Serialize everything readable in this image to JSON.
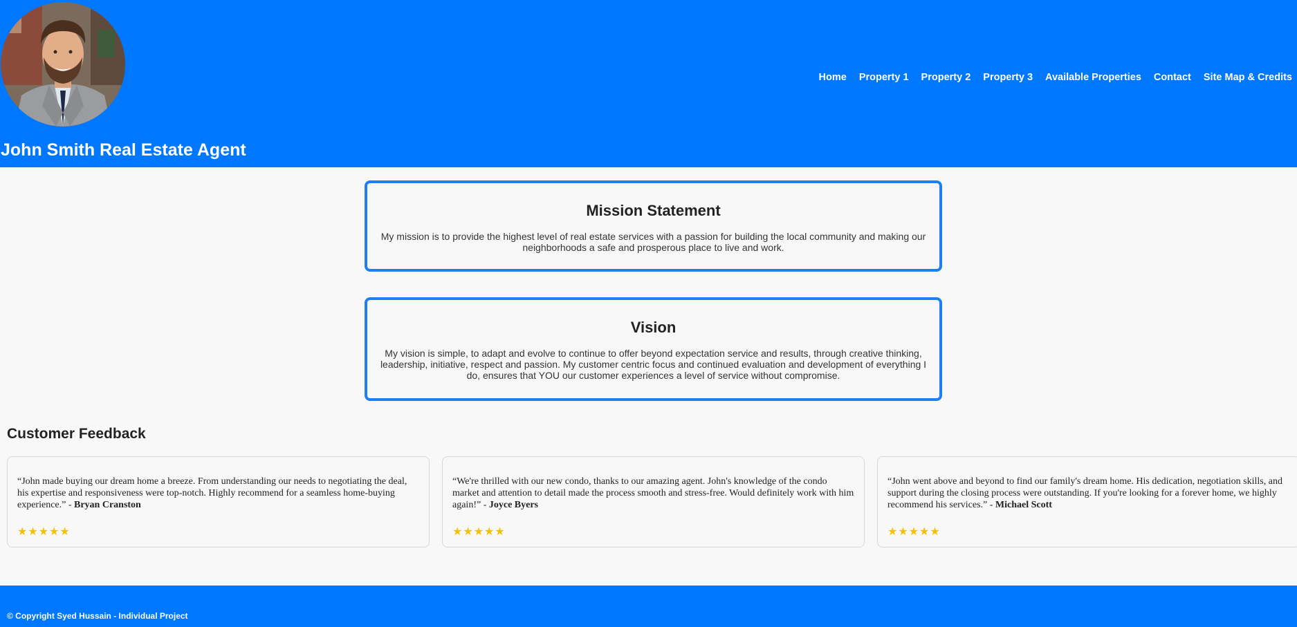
{
  "header": {
    "title": "John Smith Real Estate Agent",
    "nav": [
      "Home",
      "Property 1",
      "Property 2",
      "Property 3",
      "Available Properties",
      "Contact",
      "Site Map & Credits"
    ],
    "avatar_icon": "agent-portrait",
    "background_color": "#0077ff"
  },
  "mission": {
    "heading": "Mission Statement",
    "text": "My mission is to provide the highest level of real estate services with a passion for building the local community and making our neighborhoods a safe and prosperous place to live and work."
  },
  "vision": {
    "heading": "Vision",
    "text": "My vision is simple, to adapt and evolve to continue to offer beyond expectation service and results, through creative thinking, leadership, initiative, respect and passion. My customer centric focus and continued evaluation and development of everything I do, ensures that YOU our customer experiences a level of service without compromise."
  },
  "feedback": {
    "heading": "Customer Feedback",
    "items": [
      {
        "quote": "“John made buying our dream home a breeze. From understanding our needs to negotiating the deal, his expertise and responsiveness were top-notch. Highly recommend for a seamless home-buying experience.” - ",
        "author": "Bryan Cranston",
        "stars": "★★★★★",
        "rating": 5
      },
      {
        "quote": "“We're thrilled with our new condo, thanks to our amazing agent. John's knowledge of the condo market and attention to detail made the process smooth and stress-free. Would definitely work with him again!” - ",
        "author": "Joyce Byers",
        "stars": "★★★★★",
        "rating": 5
      },
      {
        "quote": "“John went above and beyond to find our family's dream home. His dedication, negotiation skills, and support during the closing process were outstanding. If you're looking for a forever home, we highly recommend his services.” - ",
        "author": "Michael Scott",
        "stars": "★★★★★",
        "rating": 5
      }
    ],
    "star_color": "#f2c200"
  },
  "footer": {
    "text": "© Copyright Syed Hussain - Individual Project"
  },
  "colors": {
    "accent": "#0077ff",
    "box_border": "#1e7ff0"
  }
}
